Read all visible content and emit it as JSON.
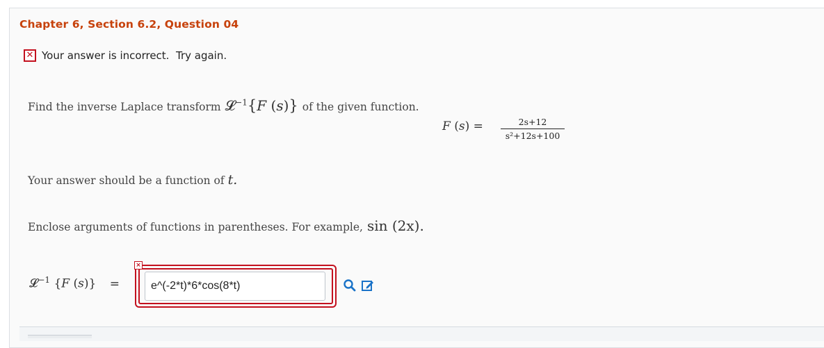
{
  "header": {
    "title": "Chapter 6, Section 6.2, Question 04"
  },
  "status": {
    "icon": "error-x-icon",
    "message": "Your answer is incorrect.  Try again."
  },
  "question": {
    "prompt_prefix": "Find the inverse Laplace transform",
    "prompt_suffix": "of the given function.",
    "function_lhs": "F (s) =",
    "function_numerator": "2s+12",
    "function_denominator": "s²+12s+100",
    "instruction_1_prefix": "Your answer should be a function of",
    "instruction_1_var": "t.",
    "instruction_2_prefix": "Enclose arguments of functions in parentheses. For example,",
    "instruction_2_example": "sin (2x)."
  },
  "answer": {
    "label": "L⁻¹ {F (s)} =",
    "value": "e^(-2*t)*6*cos(8*t)",
    "error_flag": "×"
  },
  "colors": {
    "title": "#c7420c",
    "error": "#c3101e",
    "tool_icon": "#1a73c8"
  },
  "tools": [
    "preview-icon",
    "edit-icon"
  ]
}
